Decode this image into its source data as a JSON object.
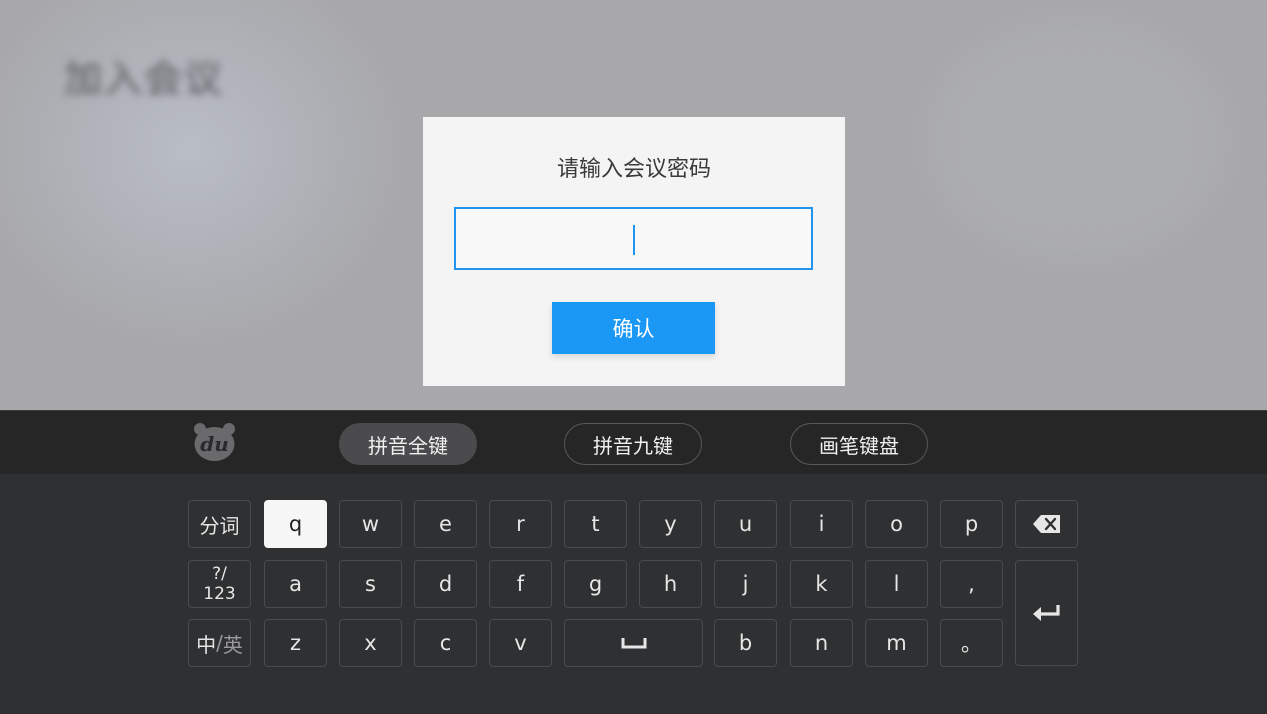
{
  "background": {
    "page_title": "加入会议"
  },
  "dialog": {
    "title": "请输入会议密码",
    "password_value": "",
    "confirm_label": "确认"
  },
  "keyboard": {
    "modes": [
      "拼音全键",
      "拼音九键",
      "画笔键盘"
    ],
    "active_mode": "拼音全键",
    "row1": [
      "分词",
      "q",
      "w",
      "e",
      "r",
      "t",
      "y",
      "u",
      "i",
      "o",
      "p"
    ],
    "row2": [
      "a",
      "s",
      "d",
      "f",
      "g",
      "h",
      "j",
      "k",
      "l",
      ","
    ],
    "row3": [
      "z",
      "x",
      "c",
      "v",
      "b",
      "n",
      "m",
      "。"
    ],
    "sym_key": {
      "line1": "?/",
      "line2": "123"
    },
    "lang_key": {
      "zh": "中",
      "sep": "/",
      "en": "英"
    },
    "selected_key": "q",
    "icons": {
      "logo": "du-bear-logo-icon",
      "backspace": "backspace-icon",
      "enter": "enter-icon",
      "space": "space-icon"
    },
    "colors": {
      "accent": "#1b98f5",
      "keyboard_bg": "#2f3031",
      "toolbar_bg": "#262627"
    }
  }
}
